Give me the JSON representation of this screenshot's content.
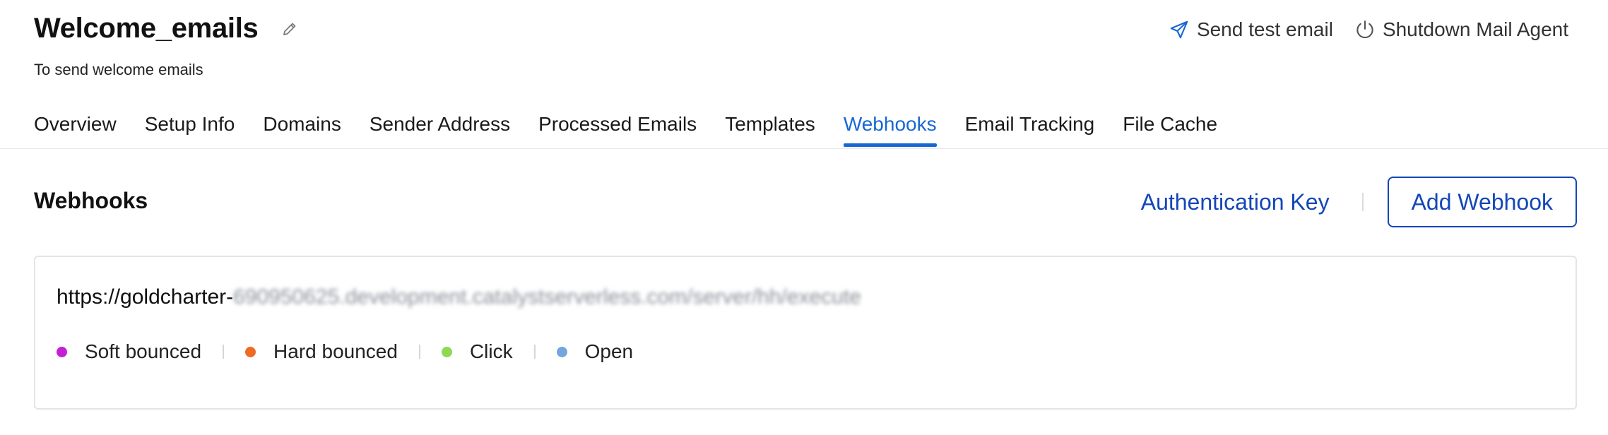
{
  "header": {
    "title": "Welcome_emails",
    "subtitle": "To send welcome emails",
    "actions": {
      "send_test_email": "Send test email",
      "shutdown_mail_agent": "Shutdown Mail Agent"
    }
  },
  "tabs": [
    {
      "label": "Overview",
      "active": false
    },
    {
      "label": "Setup Info",
      "active": false
    },
    {
      "label": "Domains",
      "active": false
    },
    {
      "label": "Sender Address",
      "active": false
    },
    {
      "label": "Processed Emails",
      "active": false
    },
    {
      "label": "Templates",
      "active": false
    },
    {
      "label": "Webhooks",
      "active": true
    },
    {
      "label": "Email Tracking",
      "active": false
    },
    {
      "label": "File Cache",
      "active": false
    }
  ],
  "section": {
    "title": "Webhooks",
    "auth_key_label": "Authentication Key",
    "add_webhook_label": "Add Webhook"
  },
  "webhook": {
    "url_visible": "https://goldcharter-",
    "url_blurred": "690950625.development.catalystserverless.com/server/hh/execute",
    "events": [
      {
        "label": "Soft bounced",
        "color": "#c51fd6"
      },
      {
        "label": "Hard bounced",
        "color": "#ef6a24"
      },
      {
        "label": "Click",
        "color": "#8ed853"
      },
      {
        "label": "Open",
        "color": "#73a6dc"
      }
    ]
  },
  "colors": {
    "accent": "#1967d2",
    "button_blue": "#1346b8"
  }
}
